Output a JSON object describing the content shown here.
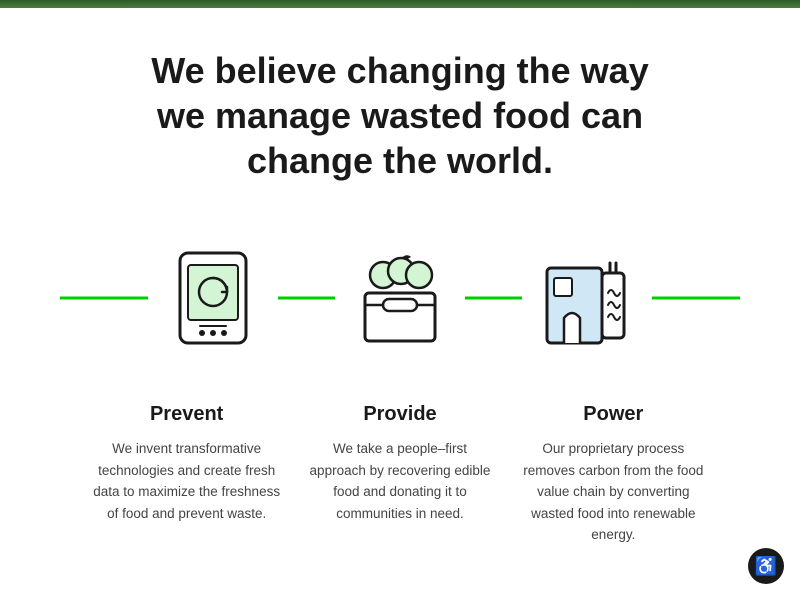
{
  "page": {
    "top_strip_color": "#3a6b35"
  },
  "headline": {
    "line1": "We believe changing the way",
    "line2": "we manage wasted food can",
    "line3": "change the world."
  },
  "columns": [
    {
      "id": "prevent",
      "title": "Prevent",
      "text": "We invent transformative technologies and create fresh data to maximize the freshness of food and prevent waste."
    },
    {
      "id": "provide",
      "title": "Provide",
      "text": "We take a people–first approach by recovering edible food and donating it to communities in need."
    },
    {
      "id": "power",
      "title": "Power",
      "text": "Our proprietary process removes carbon from the food value chain by converting wasted food into renewable energy."
    }
  ],
  "accessibility": {
    "label": "Accessibility"
  }
}
